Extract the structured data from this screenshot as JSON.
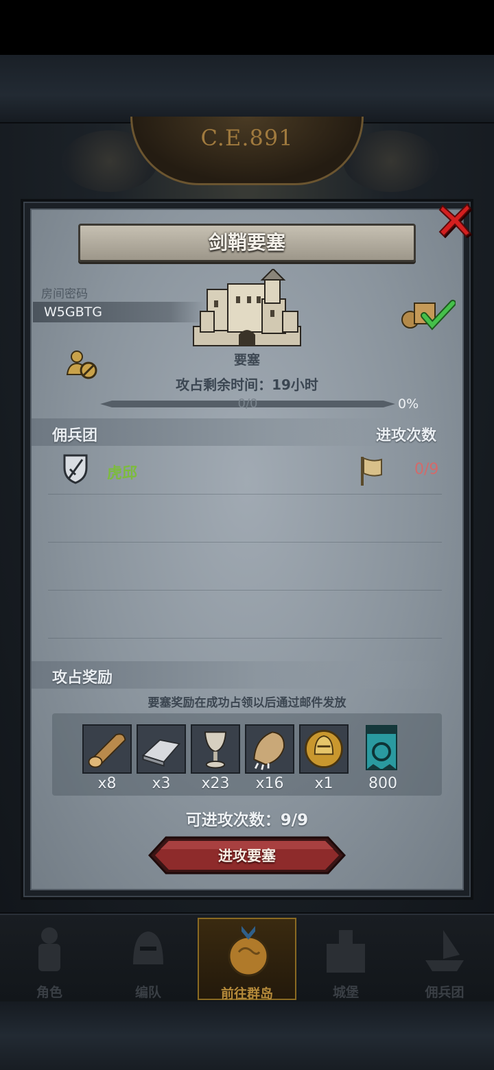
{
  "era": {
    "label": "C.E.891"
  },
  "dialog": {
    "title": "剑鞘要塞",
    "close_icon": "close-icon",
    "room": {
      "label": "房间密码",
      "code": "W5GBTG"
    },
    "fortress": {
      "label": "要塞"
    },
    "capture_time": {
      "text": "攻占剩余时间：19小时"
    },
    "progress": {
      "text": "0/0",
      "percent_text": "0%",
      "fraction": 0
    },
    "table": {
      "col_guild": "佣兵团",
      "col_attacks": "进攻次数",
      "rows": [
        {
          "guild": "虎邱",
          "attacks": "0/9"
        }
      ]
    },
    "rewards": {
      "title": "攻占奖励",
      "note": "要塞奖励在成功占领以后通过邮件发放",
      "items": [
        {
          "icon": "wood-log-icon",
          "qty": "x8"
        },
        {
          "icon": "iron-ingot-icon",
          "qty": "x3"
        },
        {
          "icon": "goblet-icon",
          "qty": "x23"
        },
        {
          "icon": "pelt-icon",
          "qty": "x16"
        },
        {
          "icon": "helmet-coin-icon",
          "qty": "x1"
        },
        {
          "icon": "guild-banner-icon",
          "qty": "800"
        }
      ]
    },
    "attacks_left": "可进攻次数：9/9",
    "attack_button": "进攻要塞"
  },
  "nav": [
    {
      "label": "角色",
      "icon": "knight-icon"
    },
    {
      "label": "编队",
      "icon": "helmet-icon"
    },
    {
      "label": "前往群岛",
      "icon": "map-compass-icon",
      "active": true
    },
    {
      "label": "城堡",
      "icon": "castle-icon"
    },
    {
      "label": "佣兵团",
      "icon": "ship-icon"
    }
  ],
  "colors": {
    "accent_green": "#7dbb3e",
    "attack_red": "#d36a6a",
    "button_red": "#8e2b2b",
    "gold": "#c9a24a"
  }
}
